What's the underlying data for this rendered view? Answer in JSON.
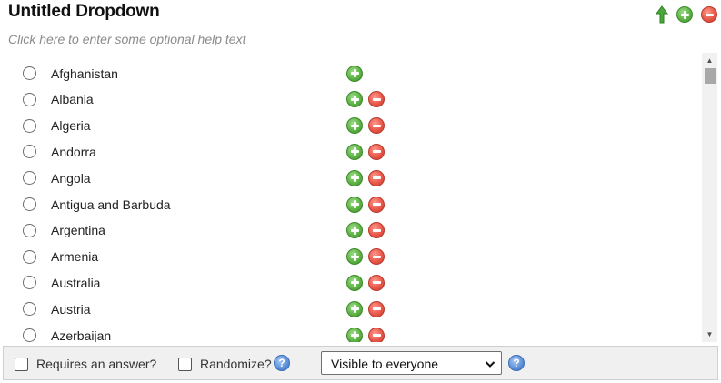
{
  "title": "Untitled Dropdown",
  "help_text": "Click here to enter some optional help text",
  "icons": {
    "move_up": "arrow-up-icon",
    "add": "plus-circle-icon",
    "remove": "minus-circle-icon",
    "help": "question-circle-icon"
  },
  "colors": {
    "add": "#5fb347",
    "remove": "#e8584a",
    "help": "#5a8fd8",
    "arrow": "#4aa83a"
  },
  "options": [
    {
      "label": "Afghanistan",
      "removable": false
    },
    {
      "label": "Albania",
      "removable": true
    },
    {
      "label": "Algeria",
      "removable": true
    },
    {
      "label": "Andorra",
      "removable": true
    },
    {
      "label": "Angola",
      "removable": true
    },
    {
      "label": "Antigua and Barbuda",
      "removable": true
    },
    {
      "label": "Argentina",
      "removable": true
    },
    {
      "label": "Armenia",
      "removable": true
    },
    {
      "label": "Australia",
      "removable": true
    },
    {
      "label": "Austria",
      "removable": true
    },
    {
      "label": "Azerbaijan",
      "removable": true
    }
  ],
  "footer": {
    "requires_answer_label": "Requires an answer?",
    "randomize_label": "Randomize?",
    "visibility_selected": "Visible to everyone",
    "help_glyph": "?"
  }
}
